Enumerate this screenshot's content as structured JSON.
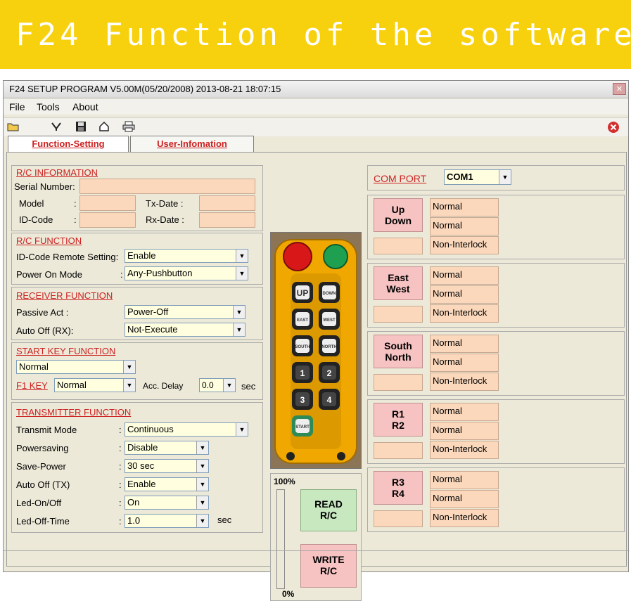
{
  "banner": {
    "title": "F24 Function of the software"
  },
  "window": {
    "title": "F24 SETUP PROGRAM V5.00M(05/20/2008)  2013-08-21  18:07:15",
    "close_icon": "close-icon"
  },
  "menu": {
    "file": "File",
    "tools": "Tools",
    "about": "About"
  },
  "toolbar": [
    "open-folder-icon",
    "import-icon",
    "save-icon",
    "home-icon",
    "print-icon",
    "exit-icon"
  ],
  "tabs": {
    "function_setting": "Function-Setting",
    "user_information": "User-Infomation"
  },
  "rc_info": {
    "title": "R/C INFORMATION",
    "serial_label": "Serial Number:",
    "serial_value": "",
    "model_label": "Model",
    "model_colon": ":",
    "model_value": "",
    "txdate_label": "Tx-Date :",
    "txdate_value": "",
    "idcode_label": "ID-Code",
    "idcode_colon": ":",
    "idcode_value": "",
    "rxdate_label": "Rx-Date :",
    "rxdate_value": ""
  },
  "rc_function": {
    "title": "R/C  FUNCTION",
    "idcode_label": "ID-Code Remote Setting:",
    "idcode_value": "Enable",
    "poweron_label": "Power On Mode",
    "poweron_value": "Any-Pushbutton"
  },
  "receiver_function": {
    "title": "RECEIVER  FUNCTION",
    "passive_label": "Passive Act  :",
    "passive_value": "Power-Off",
    "autooff_label": "Auto Off (RX):",
    "autooff_value": "Not-Execute"
  },
  "start_key": {
    "title": "START KEY FUNCTION",
    "value": "Normal",
    "f1_label": "F1 KEY",
    "f1_value": "Normal",
    "acc_label": "Acc. Delay",
    "acc_value": "0.0",
    "acc_unit": "sec"
  },
  "transmitter_function": {
    "title": "TRANSMITTER FUNCTION",
    "rows": [
      {
        "label": "Transmit Mode",
        "value": "Continuous"
      },
      {
        "label": "Powersaving",
        "value": "Disable"
      },
      {
        "label": "Save-Power",
        "value": "30 sec"
      },
      {
        "label": "Auto Off (TX)",
        "value": "Enable"
      },
      {
        "label": "Led-On/Off",
        "value": "On"
      },
      {
        "label": "Led-Off-Time",
        "value": "1.0"
      }
    ],
    "colon": ":",
    "led_off_unit": "sec"
  },
  "remote_image": {
    "buttons": [
      "UP",
      "DOWN",
      "EAST",
      "WEST",
      "SOUTH",
      "NORTH",
      "1",
      "2",
      "3",
      "4",
      "START"
    ],
    "colors": {
      "body": "#f0a800",
      "estop": "#d81818",
      "power": "#1fa050",
      "button": "#222222"
    }
  },
  "progress": {
    "top_label": "100%",
    "bottom_label": "0%",
    "fill": 0
  },
  "actions": {
    "read_line1": "READ",
    "read_line2": "R/C",
    "write_line1": "WRITE",
    "write_line2": "R/C"
  },
  "com_port": {
    "label": "COM  PORT",
    "value": "COM1"
  },
  "channels": [
    {
      "line1": "Up",
      "line2": "Down",
      "mode1": "Normal",
      "mode2": "Normal",
      "interlock": "Non-Interlock"
    },
    {
      "line1": "East",
      "line2": "West",
      "mode1": "Normal",
      "mode2": "Normal",
      "interlock": "Non-Interlock"
    },
    {
      "line1": "South",
      "line2": "North",
      "mode1": "Normal",
      "mode2": "Normal",
      "interlock": "Non-Interlock"
    },
    {
      "line1": "R1",
      "line2": "R2",
      "mode1": "Normal",
      "mode2": "Normal",
      "interlock": "Non-Interlock"
    },
    {
      "line1": "R3",
      "line2": "R4",
      "mode1": "Normal",
      "mode2": "Normal",
      "interlock": "Non-Interlock"
    }
  ],
  "accent_colors": {
    "banner": "#f7d10e",
    "title_red": "#cc2222",
    "field": "#fbd8bc",
    "select": "#ffffe0",
    "read_btn": "#c8e8c0",
    "write_btn": "#f6c2c2"
  }
}
